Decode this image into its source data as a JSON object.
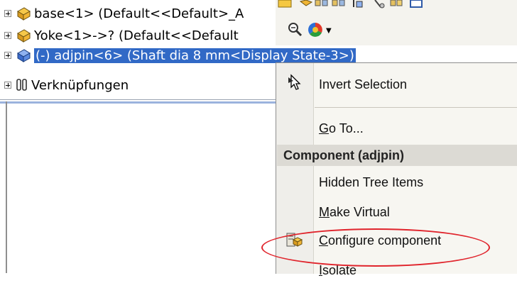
{
  "tree": {
    "items": [
      {
        "label": "base<1> (Default<<Default>_A",
        "selected": false
      },
      {
        "label": "Yoke<1>->? (Default<<Default",
        "selected": false
      },
      {
        "prefix": "(-)",
        "label": " adjpin<6> (Shaft dia 8 mm<Display State-3>)",
        "selected": true
      },
      {
        "label": "Verknüpfungen",
        "selected": false
      }
    ]
  },
  "toolbar": {
    "icons": [
      "folder-icon",
      "hide-show-icon",
      "view-icon",
      "view-icon",
      "insert-icon",
      "mate-icon",
      "move-icon",
      "display-icon",
      "zoom-icon",
      "appearance-icon"
    ]
  },
  "context_menu": {
    "items": [
      {
        "label": "Invert Selection",
        "icon": "cursor-select-icon"
      },
      {
        "label": "Go To...",
        "mnemonic": "G"
      },
      {
        "header": "Component (adjpin)"
      },
      {
        "label": "Hidden Tree Items"
      },
      {
        "label": "Make Virtual",
        "mnemonic": "M"
      },
      {
        "label": "Configure component",
        "mnemonic": "C",
        "icon": "configure-component-icon",
        "highlighted": true
      },
      {
        "label": "Isolate",
        "mnemonic": "I"
      }
    ],
    "colors": {
      "highlight": "#e0242c",
      "selection": "#3169c6"
    }
  }
}
